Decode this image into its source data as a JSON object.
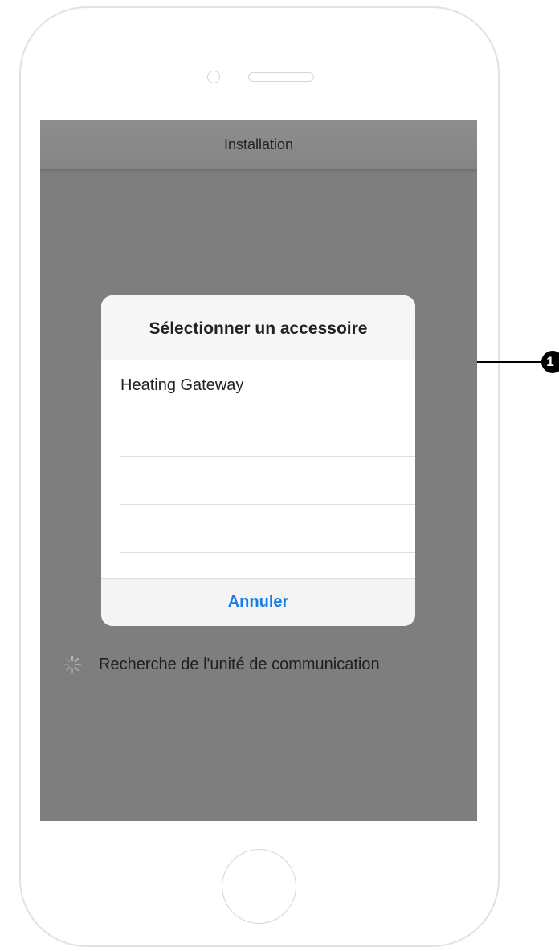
{
  "navbar": {
    "title": "Installation"
  },
  "dialog": {
    "title": "Sélectionner un accessoire",
    "items": [
      {
        "label": "Heating Gateway"
      },
      {
        "label": ""
      },
      {
        "label": ""
      },
      {
        "label": ""
      }
    ],
    "cancel_label": "Annuler"
  },
  "status": {
    "text": "Recherche de l'unité de communication",
    "icon": "spinner-icon"
  },
  "callout": {
    "number": "1"
  },
  "colors": {
    "accent": "#1a7de4",
    "overlay": "#7e7e7e",
    "callout": "#000000"
  }
}
